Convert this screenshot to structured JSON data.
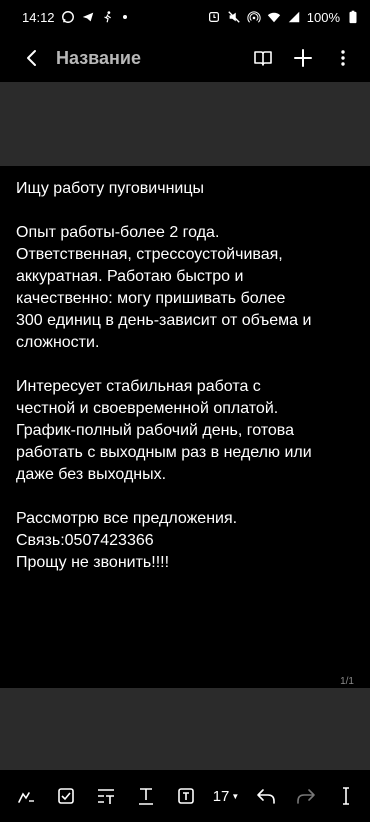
{
  "status": {
    "time": "14:12",
    "battery": "100%"
  },
  "appbar": {
    "title": "Название"
  },
  "note": {
    "paragraphs": [
      "Ищу работу пуговичницы",
      "Опыт работы-более 2 года.\nОтветственная, стрессоустойчивая,\nаккуратная. Работаю быстро и\nкачественно: могу пришивать более\n300 единиц в день-зависит от объема и\nсложности.",
      "Интересует стабильная работа с\nчестной и своевременной оплатой.\nГрафик-полный рабочий день, готова\nработать с выходным раз в неделю или\nдаже без выходных.",
      "Рассмотрю все предложения.\nСвязь:0507423366\nПрощу не звонить!!!!"
    ],
    "page_counter": "1/1"
  },
  "toolbar": {
    "font_size": "17"
  },
  "icons": {
    "back": "chevron-left-icon",
    "book": "book-icon",
    "add": "plus-icon",
    "more": "more-vertical-icon"
  }
}
